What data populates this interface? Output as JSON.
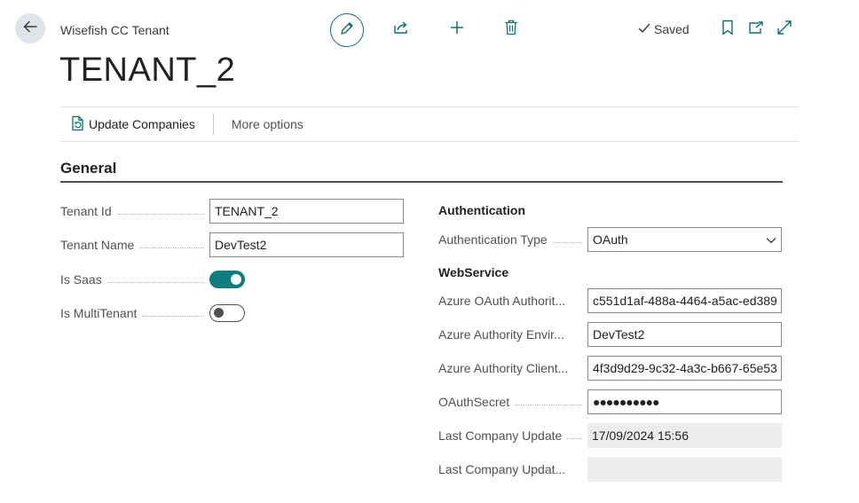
{
  "header": {
    "caption": "Wisefish CC Tenant",
    "title": "TENANT_2",
    "saved_label": "Saved"
  },
  "actions": {
    "update_companies": "Update Companies",
    "more_options": "More options"
  },
  "general": {
    "section_title": "General",
    "tenant_id": {
      "label": "Tenant Id",
      "value": "TENANT_2"
    },
    "tenant_name": {
      "label": "Tenant Name",
      "value": "DevTest2"
    },
    "is_saas": {
      "label": "Is Saas",
      "value": true
    },
    "is_multitenant": {
      "label": "Is MultiTenant",
      "value": false
    }
  },
  "authentication": {
    "group_title": "Authentication",
    "auth_type": {
      "label": "Authentication Type",
      "value": "OAuth"
    }
  },
  "webservice": {
    "group_title": "WebService",
    "azure_oauth_authority": {
      "label": "Azure OAuth Authorit...",
      "value": "c551d1af-488a-4464-a5ac-ed389"
    },
    "azure_authority_env": {
      "label": "Azure Authority Envir...",
      "value": "DevTest2"
    },
    "azure_authority_client": {
      "label": "Azure Authority Client...",
      "value": "4f3d9d29-9c32-4a3c-b667-65e53"
    },
    "oauth_secret": {
      "label": "OAuthSecret",
      "value": "●●●●●●●●●●"
    },
    "last_company_update": {
      "label": "Last Company Update",
      "value": "17/09/2024 15:56"
    },
    "last_company_update_2": {
      "label": "Last Company Updat...",
      "value": ""
    }
  },
  "colors": {
    "accent": "#0f7d80",
    "readonly_bg": "#ececec"
  }
}
